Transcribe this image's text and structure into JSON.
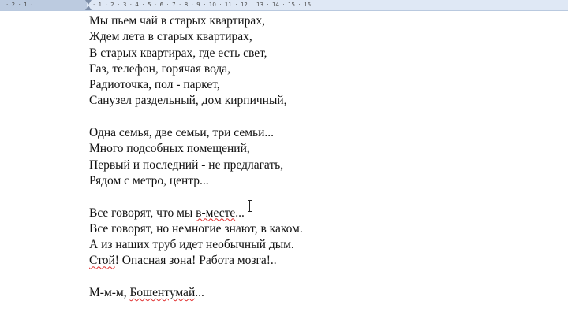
{
  "ruler": {
    "left_labels": "·  2  ·  1  ·",
    "right_labels": "·  1  ·  2  ·  3  ·  4  ·  5  ·  6  ·  7  ·  8  ·  9  ·  10  ·  11  ·  12  ·  13  ·  14  ·  15  ·  16"
  },
  "document": {
    "stanza1": [
      "Мы пьем чай в старых квартирах,",
      "Ждем лета в старых квартирах,",
      "В старых квартирах, где есть свет,",
      "Газ, телефон, горячая вода,",
      "Радиоточка, пол - паркет,",
      "Санузел раздельный, дом кирпичный,"
    ],
    "stanza2": [
      "Одна семья, две семьи, три семьи...",
      "Много подсобных помещений,",
      "Первый и последний - не предлагать,",
      "Рядом с метро, центр..."
    ],
    "stanza3": {
      "line1_before": "Все говорят, что мы ",
      "line1_misspelled": "в-месте",
      "line1_after": "...",
      "line2": "Все говорят, но немногие знают, в каком.",
      "line3": "А из наших труб идет необычный дым.",
      "line4_misspelled": "Стой",
      "line4_after": "! Опасная зона! Работа мозга!.."
    },
    "stanza4": {
      "before": "М-м-м, ",
      "misspelled": "Бошентумай",
      "after": "..."
    }
  }
}
